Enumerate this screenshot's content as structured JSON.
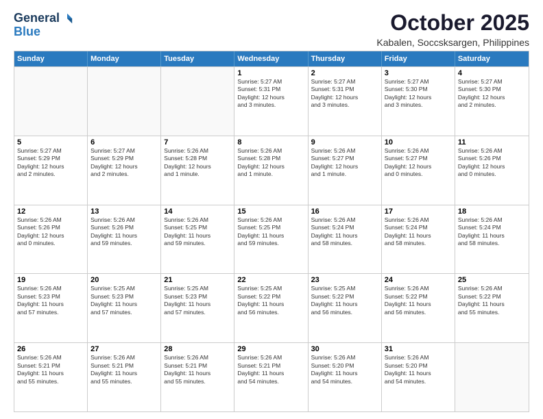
{
  "logo": {
    "line1": "General",
    "line2": "Blue"
  },
  "title": "October 2025",
  "subtitle": "Kabalen, Soccsksargen, Philippines",
  "header": {
    "days": [
      "Sunday",
      "Monday",
      "Tuesday",
      "Wednesday",
      "Thursday",
      "Friday",
      "Saturday"
    ]
  },
  "rows": [
    [
      {
        "day": "",
        "empty": true
      },
      {
        "day": "",
        "empty": true
      },
      {
        "day": "",
        "empty": true
      },
      {
        "day": "1",
        "line1": "Sunrise: 5:27 AM",
        "line2": "Sunset: 5:31 PM",
        "line3": "Daylight: 12 hours",
        "line4": "and 3 minutes."
      },
      {
        "day": "2",
        "line1": "Sunrise: 5:27 AM",
        "line2": "Sunset: 5:31 PM",
        "line3": "Daylight: 12 hours",
        "line4": "and 3 minutes."
      },
      {
        "day": "3",
        "line1": "Sunrise: 5:27 AM",
        "line2": "Sunset: 5:30 PM",
        "line3": "Daylight: 12 hours",
        "line4": "and 3 minutes."
      },
      {
        "day": "4",
        "line1": "Sunrise: 5:27 AM",
        "line2": "Sunset: 5:30 PM",
        "line3": "Daylight: 12 hours",
        "line4": "and 2 minutes."
      }
    ],
    [
      {
        "day": "5",
        "line1": "Sunrise: 5:27 AM",
        "line2": "Sunset: 5:29 PM",
        "line3": "Daylight: 12 hours",
        "line4": "and 2 minutes."
      },
      {
        "day": "6",
        "line1": "Sunrise: 5:27 AM",
        "line2": "Sunset: 5:29 PM",
        "line3": "Daylight: 12 hours",
        "line4": "and 2 minutes."
      },
      {
        "day": "7",
        "line1": "Sunrise: 5:26 AM",
        "line2": "Sunset: 5:28 PM",
        "line3": "Daylight: 12 hours",
        "line4": "and 1 minute."
      },
      {
        "day": "8",
        "line1": "Sunrise: 5:26 AM",
        "line2": "Sunset: 5:28 PM",
        "line3": "Daylight: 12 hours",
        "line4": "and 1 minute."
      },
      {
        "day": "9",
        "line1": "Sunrise: 5:26 AM",
        "line2": "Sunset: 5:27 PM",
        "line3": "Daylight: 12 hours",
        "line4": "and 1 minute."
      },
      {
        "day": "10",
        "line1": "Sunrise: 5:26 AM",
        "line2": "Sunset: 5:27 PM",
        "line3": "Daylight: 12 hours",
        "line4": "and 0 minutes."
      },
      {
        "day": "11",
        "line1": "Sunrise: 5:26 AM",
        "line2": "Sunset: 5:26 PM",
        "line3": "Daylight: 12 hours",
        "line4": "and 0 minutes."
      }
    ],
    [
      {
        "day": "12",
        "line1": "Sunrise: 5:26 AM",
        "line2": "Sunset: 5:26 PM",
        "line3": "Daylight: 12 hours",
        "line4": "and 0 minutes."
      },
      {
        "day": "13",
        "line1": "Sunrise: 5:26 AM",
        "line2": "Sunset: 5:26 PM",
        "line3": "Daylight: 11 hours",
        "line4": "and 59 minutes."
      },
      {
        "day": "14",
        "line1": "Sunrise: 5:26 AM",
        "line2": "Sunset: 5:25 PM",
        "line3": "Daylight: 11 hours",
        "line4": "and 59 minutes."
      },
      {
        "day": "15",
        "line1": "Sunrise: 5:26 AM",
        "line2": "Sunset: 5:25 PM",
        "line3": "Daylight: 11 hours",
        "line4": "and 59 minutes."
      },
      {
        "day": "16",
        "line1": "Sunrise: 5:26 AM",
        "line2": "Sunset: 5:24 PM",
        "line3": "Daylight: 11 hours",
        "line4": "and 58 minutes."
      },
      {
        "day": "17",
        "line1": "Sunrise: 5:26 AM",
        "line2": "Sunset: 5:24 PM",
        "line3": "Daylight: 11 hours",
        "line4": "and 58 minutes."
      },
      {
        "day": "18",
        "line1": "Sunrise: 5:26 AM",
        "line2": "Sunset: 5:24 PM",
        "line3": "Daylight: 11 hours",
        "line4": "and 58 minutes."
      }
    ],
    [
      {
        "day": "19",
        "line1": "Sunrise: 5:26 AM",
        "line2": "Sunset: 5:23 PM",
        "line3": "Daylight: 11 hours",
        "line4": "and 57 minutes."
      },
      {
        "day": "20",
        "line1": "Sunrise: 5:25 AM",
        "line2": "Sunset: 5:23 PM",
        "line3": "Daylight: 11 hours",
        "line4": "and 57 minutes."
      },
      {
        "day": "21",
        "line1": "Sunrise: 5:25 AM",
        "line2": "Sunset: 5:23 PM",
        "line3": "Daylight: 11 hours",
        "line4": "and 57 minutes."
      },
      {
        "day": "22",
        "line1": "Sunrise: 5:25 AM",
        "line2": "Sunset: 5:22 PM",
        "line3": "Daylight: 11 hours",
        "line4": "and 56 minutes."
      },
      {
        "day": "23",
        "line1": "Sunrise: 5:25 AM",
        "line2": "Sunset: 5:22 PM",
        "line3": "Daylight: 11 hours",
        "line4": "and 56 minutes."
      },
      {
        "day": "24",
        "line1": "Sunrise: 5:26 AM",
        "line2": "Sunset: 5:22 PM",
        "line3": "Daylight: 11 hours",
        "line4": "and 56 minutes."
      },
      {
        "day": "25",
        "line1": "Sunrise: 5:26 AM",
        "line2": "Sunset: 5:22 PM",
        "line3": "Daylight: 11 hours",
        "line4": "and 55 minutes."
      }
    ],
    [
      {
        "day": "26",
        "line1": "Sunrise: 5:26 AM",
        "line2": "Sunset: 5:21 PM",
        "line3": "Daylight: 11 hours",
        "line4": "and 55 minutes."
      },
      {
        "day": "27",
        "line1": "Sunrise: 5:26 AM",
        "line2": "Sunset: 5:21 PM",
        "line3": "Daylight: 11 hours",
        "line4": "and 55 minutes."
      },
      {
        "day": "28",
        "line1": "Sunrise: 5:26 AM",
        "line2": "Sunset: 5:21 PM",
        "line3": "Daylight: 11 hours",
        "line4": "and 55 minutes."
      },
      {
        "day": "29",
        "line1": "Sunrise: 5:26 AM",
        "line2": "Sunset: 5:21 PM",
        "line3": "Daylight: 11 hours",
        "line4": "and 54 minutes."
      },
      {
        "day": "30",
        "line1": "Sunrise: 5:26 AM",
        "line2": "Sunset: 5:20 PM",
        "line3": "Daylight: 11 hours",
        "line4": "and 54 minutes."
      },
      {
        "day": "31",
        "line1": "Sunrise: 5:26 AM",
        "line2": "Sunset: 5:20 PM",
        "line3": "Daylight: 11 hours",
        "line4": "and 54 minutes."
      },
      {
        "day": "",
        "empty": true
      }
    ]
  ]
}
